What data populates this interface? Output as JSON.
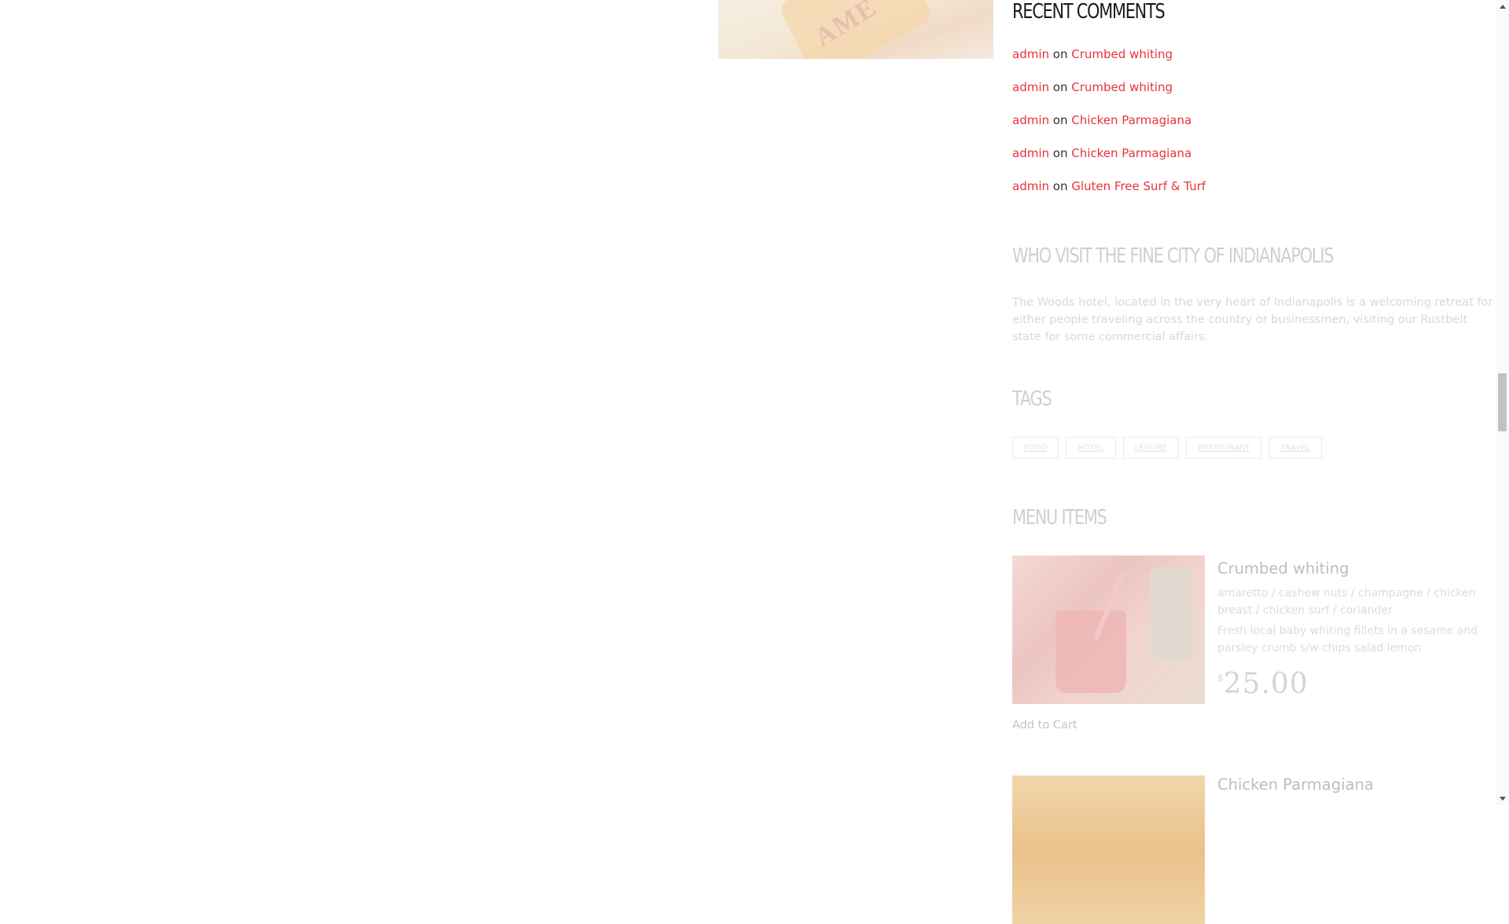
{
  "main_image": {
    "visible_text": "AME"
  },
  "sidebar": {
    "recent_comments": {
      "title": "RECENT COMMENTS",
      "items": [
        {
          "author": "admin",
          "connector": "on",
          "post": "Crumbed whiting"
        },
        {
          "author": "admin",
          "connector": "on",
          "post": "Crumbed whiting"
        },
        {
          "author": "admin",
          "connector": "on",
          "post": "Chicken Parmagiana"
        },
        {
          "author": "admin",
          "connector": "on",
          "post": "Chicken Parmagiana"
        },
        {
          "author": "admin",
          "connector": "on",
          "post": "Gluten Free Surf & Turf"
        }
      ]
    },
    "about": {
      "title": "WHO VISIT THE FINE CITY OF INDIANAPOLIS",
      "text": "The Woods hotel, located in the very heart of Indianapolis is a welcoming retreat for either people traveling across the country or businessmen, visiting our Rustbelt state for some commercial affairs."
    },
    "tags": {
      "title": "TAGS",
      "items": [
        "FOOD",
        "HOTEL",
        "LEISURE",
        "RESTAURANT",
        "TRAVEL"
      ]
    },
    "menu_items": {
      "title": "MENU ITEMS",
      "items": [
        {
          "name": "Crumbed whiting",
          "ingredients": "amaretto / cashew nuts / champagne / chicken breast / chicken surf / coriander",
          "description": "Fresh local baby whiting fillets in a sesame and parsley crumb s/w chips salad lemon",
          "currency": "$",
          "price": "25.00",
          "cart_label": "Add to Cart"
        },
        {
          "name": "Chicken Parmagiana"
        }
      ]
    }
  },
  "scrollbar": {
    "position": 0.5
  },
  "colors": {
    "accent": "#e8323e",
    "heading": "#1b1b1b",
    "faded": "#cfcfcf"
  }
}
